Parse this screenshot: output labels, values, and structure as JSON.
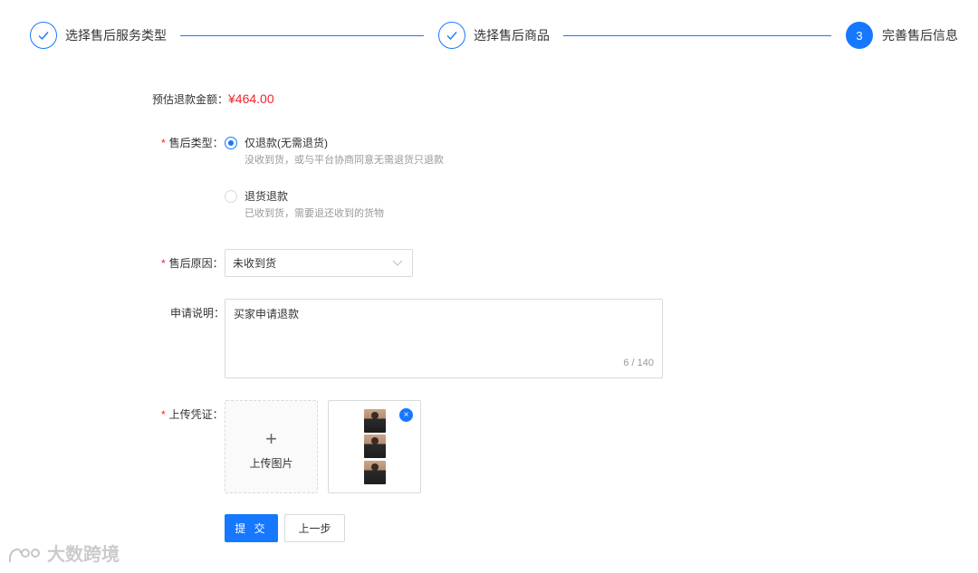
{
  "steps": [
    {
      "title": "选择售后服务类型",
      "status": "done"
    },
    {
      "title": "选择售后商品",
      "status": "done"
    },
    {
      "number": "3",
      "title": "完善售后信息",
      "status": "active"
    }
  ],
  "form": {
    "refund": {
      "label": "预估退款金额：",
      "amount": "¥464.00"
    },
    "service_type": {
      "required": "*",
      "label": "售后类型：",
      "options": [
        {
          "title": "仅退款(无需退货)",
          "desc": "没收到货，或与平台协商同意无需退货只退款",
          "checked": true
        },
        {
          "title": "退货退款",
          "desc": "已收到货，需要退还收到的货物",
          "checked": false
        }
      ]
    },
    "reason": {
      "required": "*",
      "label": "售后原因：",
      "value": "未收到货"
    },
    "description": {
      "label": "申请说明：",
      "value": "买家申请退款",
      "count": "6 / 140"
    },
    "proof": {
      "required": "*",
      "label": "上传凭证：",
      "upload_plus": "+",
      "upload_text": "上传图片",
      "remove_icon": "×"
    }
  },
  "buttons": {
    "submit": "提 交",
    "prev": "上一步"
  },
  "watermark": {
    "text": "大数跨境"
  },
  "colors": {
    "primary": "#1677ff",
    "danger": "#f5222d",
    "muted": "#999999",
    "border": "#d9d9d9"
  }
}
